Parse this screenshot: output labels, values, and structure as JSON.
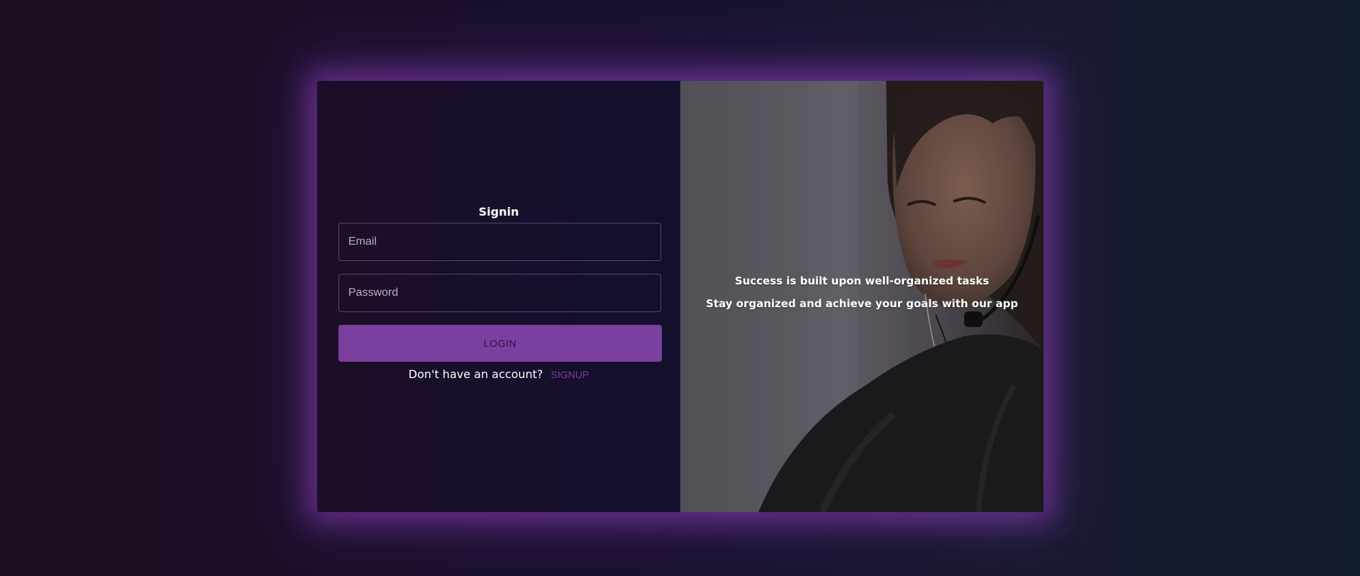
{
  "signin": {
    "title": "Signin",
    "email_placeholder": "Email",
    "password_placeholder": "Password",
    "login_label": "LOGIN",
    "no_account_text": "Don't have an account?",
    "signup_label": "SIGNUP"
  },
  "hero": {
    "line1": "Success is built upon well-organized tasks",
    "line2": "Stay organized and achieve your goals with our app",
    "image_description": "woman-with-headset-photo"
  },
  "colors": {
    "accent": "#7b3fa0",
    "glow": "#9244c4",
    "panel_bg": "#170f2c"
  }
}
